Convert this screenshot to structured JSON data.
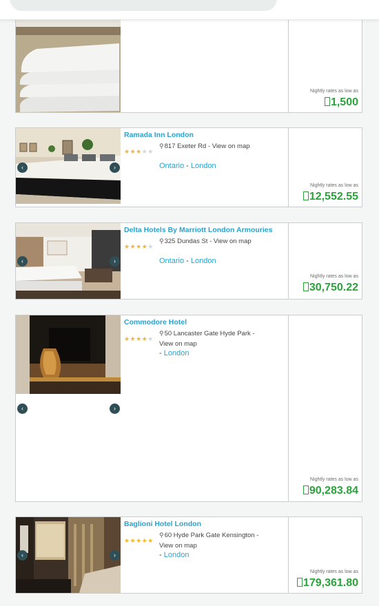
{
  "hotels": [
    {
      "name": "",
      "address": "",
      "stars": 0,
      "location": "",
      "rate_label": "Nightly rates as low as",
      "price": "1,500"
    },
    {
      "name": "Ramada Inn London",
      "address": "817 Exeter Rd - View on map",
      "stars": 3,
      "province": "Ontario",
      "city": "London",
      "rate_label": "Nightly rates as low as",
      "price": "12,552.55"
    },
    {
      "name": "Delta Hotels By Marriott London Armouries",
      "address": "325 Dundas St - View on map",
      "stars": 4,
      "province": "Ontario",
      "city": "London",
      "rate_label": "Nightly rates as low as",
      "price": "30,750.22"
    },
    {
      "name": "Commodore Hotel",
      "address": "50 Lancaster Gate Hyde Park - View on map",
      "stars": 4,
      "province": "",
      "city": "London",
      "rate_label": "Nightly rates as low as",
      "price": "90,283.84"
    },
    {
      "name": "Baglioni Hotel London",
      "address": "60 Hyde Park Gate Kensington - View on map",
      "stars": 5,
      "province": "",
      "city": "London",
      "rate_label": "Nightly rates as low as",
      "price": "179,361.80"
    }
  ],
  "colors": {
    "accent": "#26a4d0",
    "price": "#2aa33a",
    "star": "#f2b632"
  },
  "icons": {
    "pin": "map-pin-icon",
    "currency": "currency-icon",
    "prev": "chevron-left-icon",
    "next": "chevron-right-icon"
  }
}
